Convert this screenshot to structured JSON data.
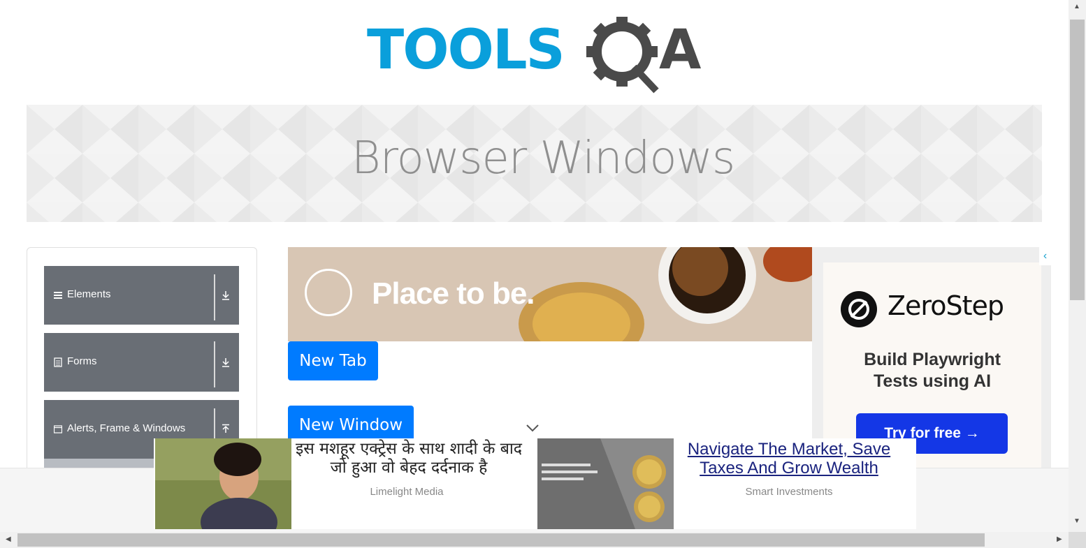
{
  "logo": {
    "text": "TOOLS",
    "q_letter": "Q",
    "a_letter": "A",
    "brand_blue": "#0a9fdb",
    "brand_grey": "#4a4a4a"
  },
  "header": {
    "title": "Browser Windows"
  },
  "sidebar": {
    "groups": [
      {
        "label": "Elements",
        "icon": "menu-icon"
      },
      {
        "label": "Forms",
        "icon": "document-icon"
      },
      {
        "label": "Alerts, Frame & Windows",
        "icon": "window-icon"
      }
    ]
  },
  "ads": {
    "top_banner": {
      "headline": "Place to be."
    },
    "right_banner": {
      "brand": "ZeroStep",
      "tagline_1": "Build Playwright",
      "tagline_2": "Tests using AI",
      "cta": "Try for free →"
    },
    "adchoices": "‹",
    "native": [
      {
        "headline": "इस मशहूर एक्ट्रेस के साथ शादी के बाद जो हुआ वो बेहद दर्दनाक है",
        "source": "Limelight Media"
      },
      {
        "headline": "Navigate The Market, Save Taxes And Grow Wealth",
        "source": "Smart Investments"
      }
    ]
  },
  "buttons": {
    "new_tab": "New Tab",
    "new_window": "New Window"
  },
  "colors": {
    "primary_button": "#007bff",
    "sidebar_group": "#696e75"
  }
}
